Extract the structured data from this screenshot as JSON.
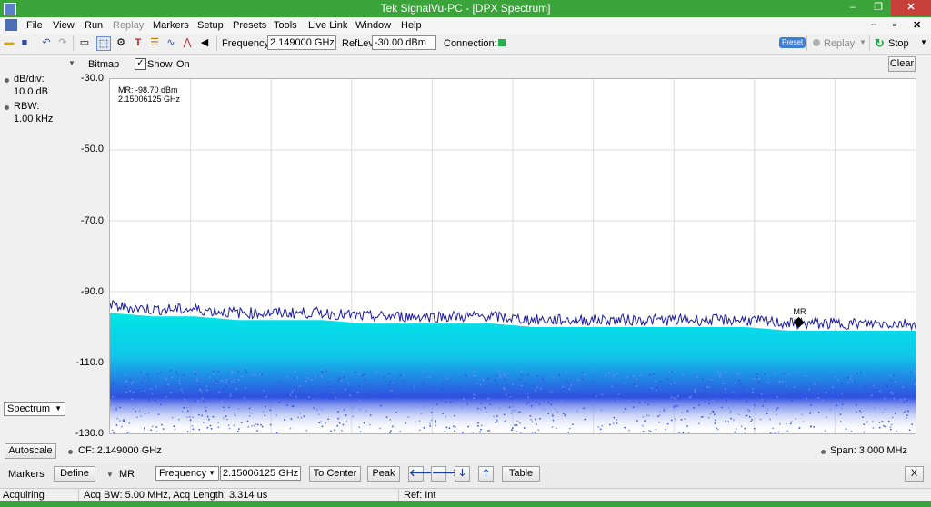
{
  "window": {
    "title": "Tek SignalVu-PC - [DPX Spectrum]",
    "minimize": "–",
    "restore": "❐",
    "close": "✕"
  },
  "menu": {
    "items": [
      "File",
      "View",
      "Run",
      "Replay",
      "Markers",
      "Setup",
      "Presets",
      "Tools",
      "Live Link",
      "Window",
      "Help"
    ],
    "mdi_minimize": "–",
    "mdi_restore": "▫",
    "mdi_close": "✕"
  },
  "toolbar": {
    "frequency_label": "Frequency:",
    "frequency_value": "2.149000 GHz",
    "reflev_label": "RefLev:",
    "reflev_value": "-30.00 dBm",
    "connection_label": "Connection:",
    "connection_color": "#22b14c",
    "preset_badge": "Preset",
    "replay_label": "Replay",
    "stop_label": "Stop"
  },
  "display_controls": {
    "bitmap_label": "Bitmap",
    "show_label": "Show",
    "show_checked": true,
    "on_label": "On",
    "clear_button": "Clear"
  },
  "left_panel": {
    "db_div_label": "dB/div:",
    "db_div_value": "10.0 dB",
    "rbw_label": "RBW:",
    "rbw_value": "1.00 kHz",
    "view_select": "Spectrum",
    "autoscale_button": "Autoscale"
  },
  "plot": {
    "y_ticks": [
      "-30.0",
      "-50.0",
      "-70.0",
      "-90.0",
      "-110.0",
      "-130.0"
    ],
    "marker_readout_level": "MR: -98.70 dBm",
    "marker_readout_freq": "2.15006125 GHz",
    "marker_label": "MR",
    "cf_text": "CF: 2.149000 GHz",
    "span_text": "Span: 3.000 MHz",
    "trace_color": "#1a1aa0",
    "bitmap_color_hot": "#00e6e6",
    "bitmap_color_cold": "#3050e0"
  },
  "chart_data": {
    "type": "line",
    "ylim": [
      -130,
      -30
    ],
    "ylabel": "",
    "xlabel": "",
    "center_frequency": "2.149000 GHz",
    "span": "3.000 MHz",
    "ref_level_dbm": -30,
    "db_per_div": 10,
    "series": [
      {
        "values": [
          -94,
          -95,
          -95,
          -96,
          -96,
          -96,
          -97,
          -97,
          -97,
          -97,
          -98,
          -98,
          -98,
          -98,
          -98,
          -98,
          -99,
          -99,
          -99,
          -99
        ]
      }
    ],
    "marker": {
      "name": "MR",
      "frequency": "2.15006125 GHz",
      "level": "-98.70 dBm",
      "x_fraction": 0.855,
      "y_dbm": -98.7
    },
    "grid": true
  },
  "marker_bar": {
    "markers_label": "Markers",
    "define_button": "Define",
    "marker_select": "MR",
    "param_select": "Frequency",
    "marker_value": "2.15006125 GHz",
    "to_center_button": "To Center",
    "peak_button": "Peak",
    "table_button": "Table",
    "close_button": "X"
  },
  "status": {
    "state": "Acquiring",
    "acq_info": "Acq BW: 5.00 MHz, Acq Length: 3.314 us",
    "ref": "Ref: Int"
  }
}
